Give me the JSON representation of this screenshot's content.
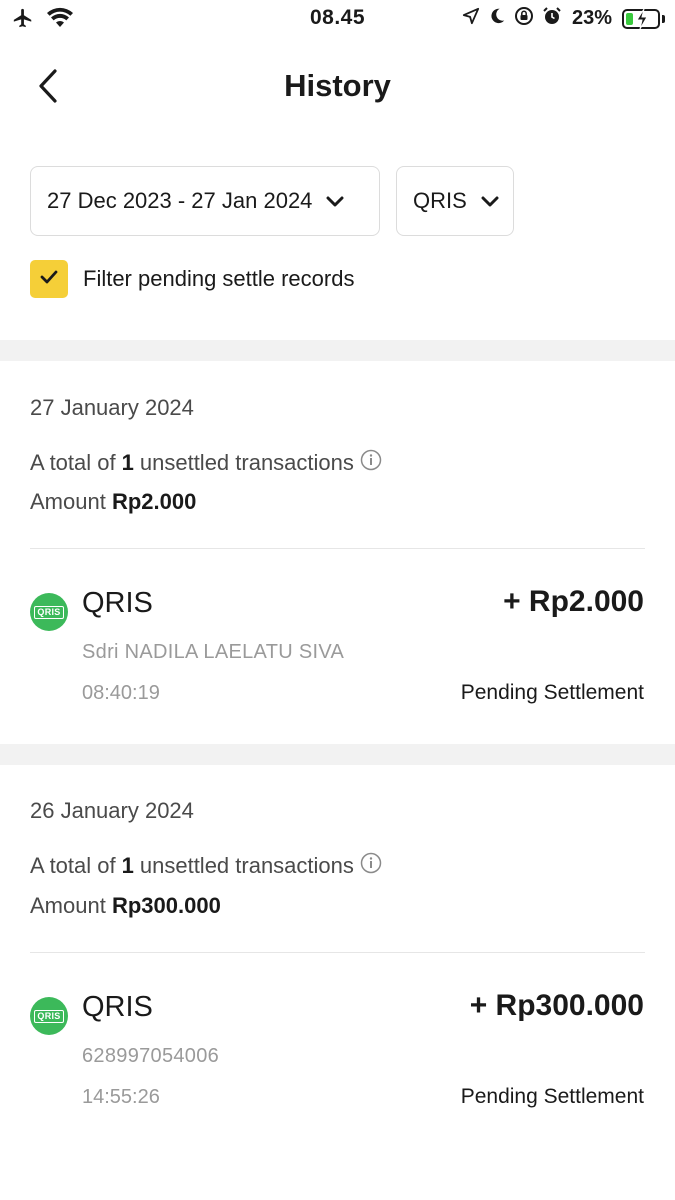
{
  "status_bar": {
    "time": "08.45",
    "battery_percent": "23%",
    "battery_level": 0.23,
    "icons": [
      "airplane-icon",
      "wifi-icon",
      "location-icon",
      "moon-icon",
      "rotation-lock-icon",
      "alarm-icon",
      "battery-icon"
    ],
    "battery_color": "#39c93d"
  },
  "header": {
    "title": "History",
    "back_icon": "chevron-left-icon"
  },
  "filters": {
    "date_range": "27 Dec 2023 - 27 Jan 2024",
    "payment_type": "QRIS",
    "pending_filter_label": "Filter pending settle records",
    "pending_filter_checked": true,
    "checkbox_color": "#f5cf38"
  },
  "sections": [
    {
      "date": "27 January 2024",
      "total_prefix": "A total of",
      "total_count": "1",
      "total_suffix": "unsettled transactions",
      "amount_label": "Amount",
      "amount_value": "Rp2.000",
      "transaction": {
        "method": "QRIS",
        "amount": "+ Rp2.000",
        "name": "Sdri NADILA LAELATU SIVA",
        "time": "08:40:19",
        "status": "Pending Settlement",
        "logo_text": "QRIS"
      }
    },
    {
      "date": "26 January 2024",
      "total_prefix": "A total of",
      "total_count": "1",
      "total_suffix": "unsettled transactions",
      "amount_label": "Amount",
      "amount_value": "Rp300.000",
      "transaction": {
        "method": "QRIS",
        "amount": "+ Rp300.000",
        "name": "628997054006",
        "time": "14:55:26",
        "status": "Pending Settlement",
        "logo_text": "QRIS"
      }
    }
  ],
  "colors": {
    "qris_green": "#3cb95a",
    "muted_text": "#9a9a9a",
    "section_band": "#f2f2f2"
  }
}
